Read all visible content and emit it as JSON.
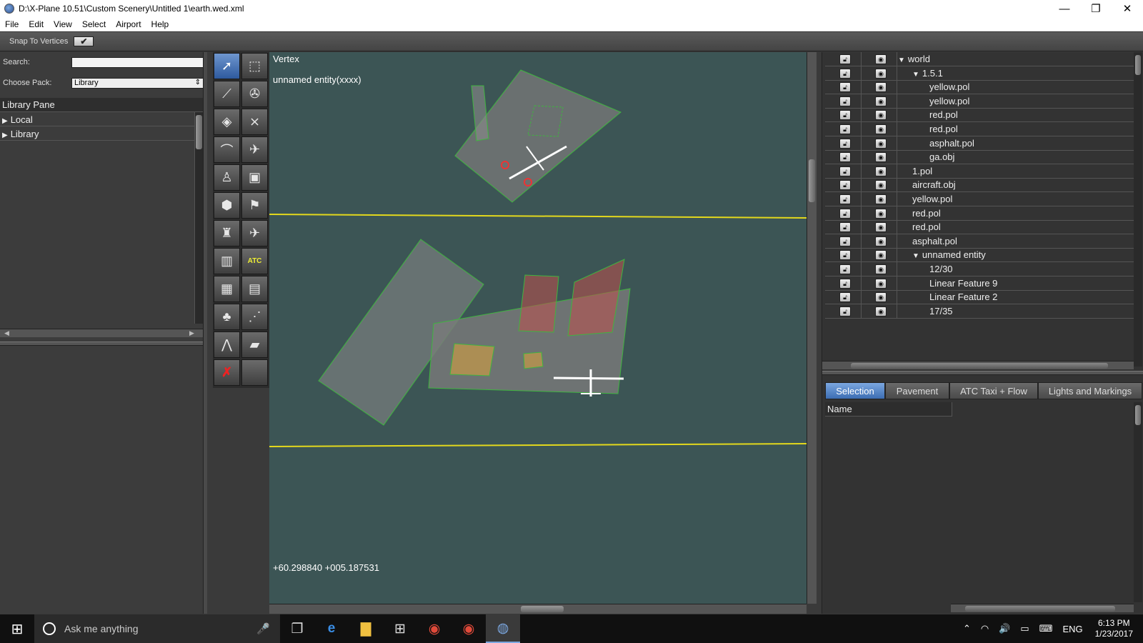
{
  "window": {
    "title": "D:\\X-Plane 10.51\\Custom Scenery\\Untitled 1\\earth.wed.xml",
    "minimize": "—",
    "maximize": "❐",
    "close": "✕"
  },
  "menu": [
    "File",
    "Edit",
    "View",
    "Select",
    "Airport",
    "Help"
  ],
  "toolbar": {
    "snap_label": "Snap To Vertices",
    "snap_checked": "✔"
  },
  "library": {
    "search_label": "Search:",
    "search_value": "",
    "pack_label": "Choose Pack:",
    "pack_value": "Library",
    "pane_title": "Library Pane",
    "items": [
      {
        "label": "Local"
      },
      {
        "label": "Library"
      }
    ]
  },
  "map": {
    "tool_name": "Vertex",
    "selection": "unnamed entity(xxxx)",
    "coords": "+60.298840 +005.187531"
  },
  "tree": [
    {
      "label": "world",
      "expanded": true
    },
    {
      "label": "1.5.1",
      "expanded": true
    },
    {
      "label": "yellow.pol"
    },
    {
      "label": "yellow.pol"
    },
    {
      "label": "red.pol"
    },
    {
      "label": "red.pol"
    },
    {
      "label": "asphalt.pol"
    },
    {
      "label": "ga.obj"
    },
    {
      "label": "1.pol"
    },
    {
      "label": "aircraft.obj"
    },
    {
      "label": "yellow.pol"
    },
    {
      "label": "red.pol"
    },
    {
      "label": "red.pol"
    },
    {
      "label": "asphalt.pol"
    },
    {
      "label": "unnamed entity",
      "expanded": true
    },
    {
      "label": "12/30"
    },
    {
      "label": "Linear Feature 9"
    },
    {
      "label": "Linear Feature 2"
    },
    {
      "label": "17/35"
    }
  ],
  "tabs": [
    "Selection",
    "Pavement",
    "ATC Taxi + Flow",
    "Lights and Markings"
  ],
  "properties": {
    "name_header": "Name"
  },
  "taskbar": {
    "search_placeholder": "Ask me anything",
    "lang": "ENG",
    "time": "6:13 PM",
    "date": "1/23/2017"
  },
  "colors": {
    "map_bg": "#3c5555",
    "accent": "#3c6db3",
    "runway_line": "#e3d81c",
    "selection_green": "#3fb53f"
  }
}
